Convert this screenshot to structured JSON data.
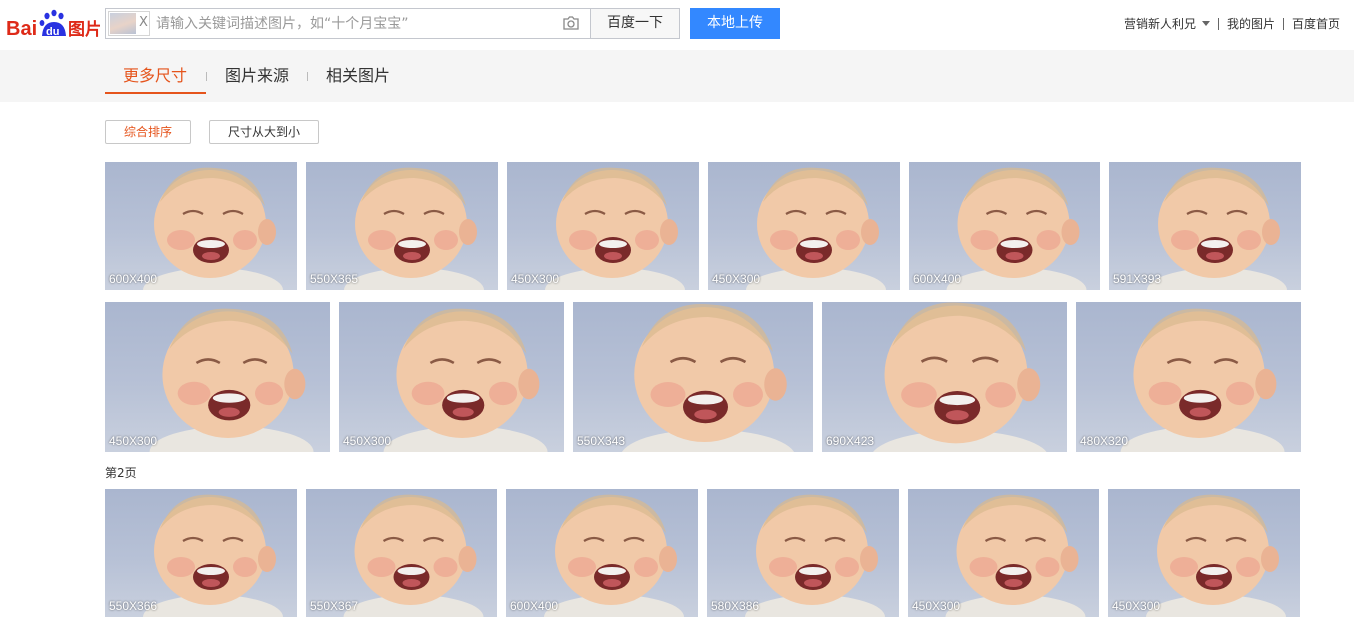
{
  "header": {
    "logo_text": "Bai du 图片",
    "search_placeholder": "请输入关键词描述图片，如“十个月宝宝”",
    "search_chip_close": "X",
    "search_button": "百度一下",
    "upload_button": "本地上传",
    "links": [
      "营销新人利兄",
      "我的图片",
      "百度首页"
    ]
  },
  "tabs": [
    {
      "label": "更多尺寸",
      "active": true
    },
    {
      "label": "图片来源",
      "active": false
    },
    {
      "label": "相关图片",
      "active": false
    }
  ],
  "sort": {
    "comprehensive": "综合排序",
    "size_desc": "尺寸从大到小"
  },
  "results": {
    "row1": [
      "600X400",
      "550X365",
      "450X300",
      "450X300",
      "600X400",
      "591X393"
    ],
    "row2": [
      "450X300",
      "450X300",
      "550X343",
      "690X423",
      "480X320"
    ],
    "page2_label": "第2页",
    "row3": [
      "550X366",
      "550X367",
      "600X400",
      "580X386",
      "450X300",
      "450X300"
    ]
  },
  "colors": {
    "accent": "#e5541c",
    "upload_blue": "#3388ff",
    "baidu_red": "#de2a18",
    "baidu_blue": "#2932e1"
  }
}
